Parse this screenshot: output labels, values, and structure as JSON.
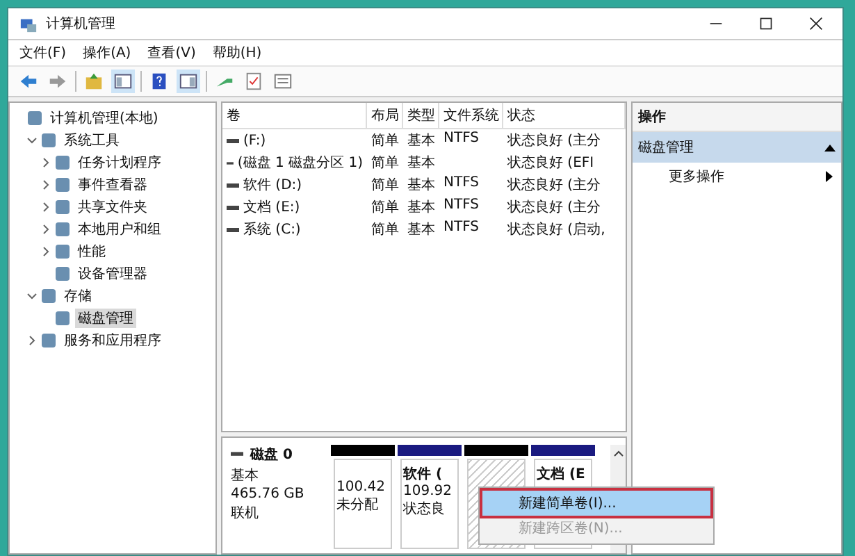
{
  "window": {
    "title": "计算机管理"
  },
  "menu": [
    "文件(F)",
    "操作(A)",
    "查看(V)",
    "帮助(H)"
  ],
  "tree": [
    {
      "label": "计算机管理(本地)",
      "selected": false,
      "children": [
        {
          "label": "系统工具",
          "selected": false,
          "expanded": true,
          "children": [
            {
              "label": "任务计划程序",
              "selected": false,
              "expanded": false
            },
            {
              "label": "事件查看器",
              "selected": false,
              "expanded": false
            },
            {
              "label": "共享文件夹",
              "selected": false,
              "expanded": false
            },
            {
              "label": "本地用户和组",
              "selected": false,
              "expanded": false
            },
            {
              "label": "性能",
              "selected": false,
              "expanded": false
            },
            {
              "label": "设备管理器",
              "selected": false
            }
          ]
        },
        {
          "label": "存储",
          "selected": false,
          "expanded": true,
          "children": [
            {
              "label": "磁盘管理",
              "selected": true
            }
          ]
        },
        {
          "label": "服务和应用程序",
          "selected": false,
          "expanded": false
        }
      ]
    }
  ],
  "volumes": {
    "columns": [
      "卷",
      "布局",
      "类型",
      "文件系统",
      "状态"
    ],
    "rows": [
      [
        "(F:)",
        "简单",
        "基本",
        "NTFS",
        "状态良好 (主分"
      ],
      [
        "(磁盘 1 磁盘分区 1)",
        "简单",
        "基本",
        "",
        "状态良好 (EFI"
      ],
      [
        "软件 (D:)",
        "简单",
        "基本",
        "NTFS",
        "状态良好 (主分"
      ],
      [
        "文档 (E:)",
        "简单",
        "基本",
        "NTFS",
        "状态良好 (主分"
      ],
      [
        "系统 (C:)",
        "简单",
        "基本",
        "NTFS",
        "状态良好 (启动,"
      ]
    ]
  },
  "disk": {
    "name": "磁盘 0",
    "type": "基本",
    "size": "465.76 GB",
    "status": "联机",
    "partitions": [
      {
        "kind": "unallocated",
        "lines": [
          "100.42",
          "未分配"
        ],
        "selected": false
      },
      {
        "kind": "primary",
        "lines": [
          "软件 (",
          "109.92",
          "状态良"
        ],
        "selected": false
      },
      {
        "kind": "unallocated",
        "selected": true
      },
      {
        "kind": "primary",
        "lines": [
          "文档 (E"
        ],
        "selected": false
      }
    ]
  },
  "actions": {
    "title": "操作",
    "section": "磁盘管理",
    "items": [
      "更多操作"
    ]
  },
  "context_menu": [
    {
      "label": "新建简单卷(I)...",
      "selected": true,
      "disabled": false
    },
    {
      "label": "新建跨区卷(N)...",
      "selected": false,
      "disabled": true
    }
  ]
}
